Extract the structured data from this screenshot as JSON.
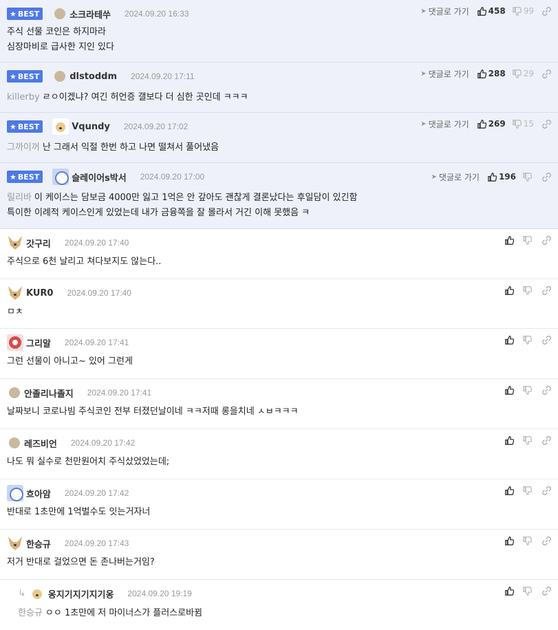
{
  "best_label": "BEST",
  "reply_label": "댓글로 가기",
  "comments": [
    {
      "author": "소크라테쑤",
      "date": "2024.09.20 16:33",
      "up": "458",
      "down": "99",
      "lines": [
        "주식 선물 코인은 하지마라",
        "심장마비로 급사한 지인 있다"
      ],
      "mention": ""
    },
    {
      "author": "dlstoddm",
      "date": "2024.09.20 17:11",
      "up": "288",
      "down": "29",
      "mention": "killerby",
      "lines": [
        "ㄹㅇ이겠냐? 여긴 허언증 갤보다 더 심한 곳인데 ㅋㅋㅋ"
      ]
    },
    {
      "author": "Vqundy",
      "date": "2024.09.20 17:02",
      "up": "269",
      "down": "15",
      "mention": "그까이꺼",
      "lines": [
        "난 그래서 익절 한번 하고 나면 떨쳐서 풀어냈음"
      ]
    },
    {
      "author": "슬레이어s박서",
      "date": "2024.09.20 17:00",
      "up": "196",
      "down": "",
      "mention": "릴리바",
      "lines": [
        "이 케이스는 담보금 4000만 잃고 1억은 안 갚아도 괜찮게 결론났다는 후일담이 있긴함",
        "특이한 이례적 케이스인게 있었는데 내가 금융쪽을 잘 몰라서 거긴 이해 못했음 ㅋ"
      ]
    },
    {
      "author": "갓구리",
      "date": "2024.09.20 17:40",
      "lines": [
        "주식으로 6천 날리고 쳐다보지도 않는다.."
      ]
    },
    {
      "author": "KUR0",
      "date": "2024.09.20 17:40",
      "lines": [
        "ㅁㅊ"
      ]
    },
    {
      "author": "그리알",
      "date": "2024.09.20 17:41",
      "lines": [
        "그런 선물이 아니고~ 있어 그런게"
      ]
    },
    {
      "author": "안졸리나졸지",
      "date": "2024.09.20 17:41",
      "lines": [
        "날짜보니 코로나빔 주식코인 전부 터졌던날이네 ㅋㅋ저때 롱을치네 ㅅㅂㅋㅋㅋ"
      ]
    },
    {
      "author": "레즈비언",
      "date": "2024.09.20 17:42",
      "lines": [
        "나도 뭐 실수로 천만원어치 주식샀었었는데;"
      ]
    },
    {
      "author": "흐아암",
      "date": "2024.09.20 17:42",
      "lines": [
        "반대로 1초만에 1억벌수도 잇는거자너"
      ]
    },
    {
      "author": "한승규",
      "date": "2024.09.20 17:43",
      "lines": [
        "저거 반대로 걸었으면 돈 존나버는거임?"
      ]
    },
    {
      "author": "옹지기지기지기옹",
      "date": "2024.09.20 19:19",
      "mention": "한승규",
      "lines": [
        "ㅇㅇ 1초만에 저 마이너스가 플러스로바뀜"
      ]
    }
  ]
}
